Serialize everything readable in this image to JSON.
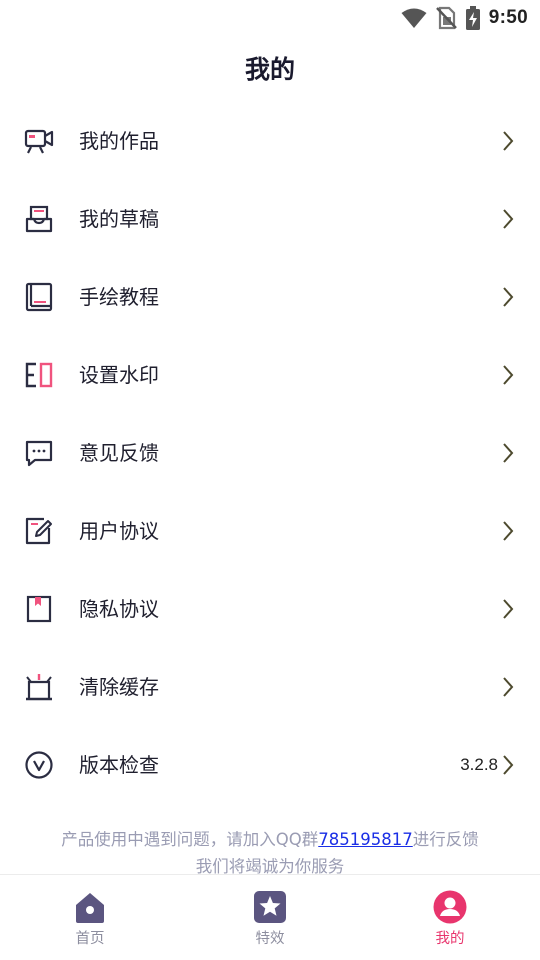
{
  "status_bar": {
    "time": "9:50",
    "icons": [
      "wifi-icon",
      "no-sim-icon",
      "battery-charging-icon"
    ]
  },
  "header": {
    "title": "我的"
  },
  "menu": {
    "items": [
      {
        "label": "我的作品",
        "icon": "video-camera-icon",
        "value": ""
      },
      {
        "label": "我的草稿",
        "icon": "inbox-draft-icon",
        "value": ""
      },
      {
        "label": "手绘教程",
        "icon": "book-icon",
        "value": ""
      },
      {
        "label": "设置水印",
        "icon": "watermark-icon",
        "value": ""
      },
      {
        "label": "意见反馈",
        "icon": "feedback-message-icon",
        "value": ""
      },
      {
        "label": "用户协议",
        "icon": "edit-document-icon",
        "value": ""
      },
      {
        "label": "隐私协议",
        "icon": "bookmark-document-icon",
        "value": ""
      },
      {
        "label": "清除缓存",
        "icon": "broom-icon",
        "value": ""
      },
      {
        "label": "版本检查",
        "icon": "version-circle-icon",
        "value": "3.2.8"
      }
    ]
  },
  "notice": {
    "line1_prefix": "产品使用中遇到问题，请加入QQ群",
    "qq_group": "785195817",
    "line1_suffix": "进行反馈",
    "line2": "我们将竭诚为你服务"
  },
  "tabbar": {
    "tabs": [
      {
        "label": "首页",
        "icon": "home-icon",
        "active": false
      },
      {
        "label": "特效",
        "icon": "star-icon",
        "active": false
      },
      {
        "label": "我的",
        "icon": "user-icon",
        "active": true
      }
    ]
  },
  "colors": {
    "icon_dark": "#2b2d42",
    "icon_accent": "#f0537e",
    "tab_inactive": "#5b5580",
    "tab_active": "#e8356d",
    "chevron": "#4d4a2e",
    "link": "#1a2ee6",
    "notice_text": "#9a9cb3"
  }
}
